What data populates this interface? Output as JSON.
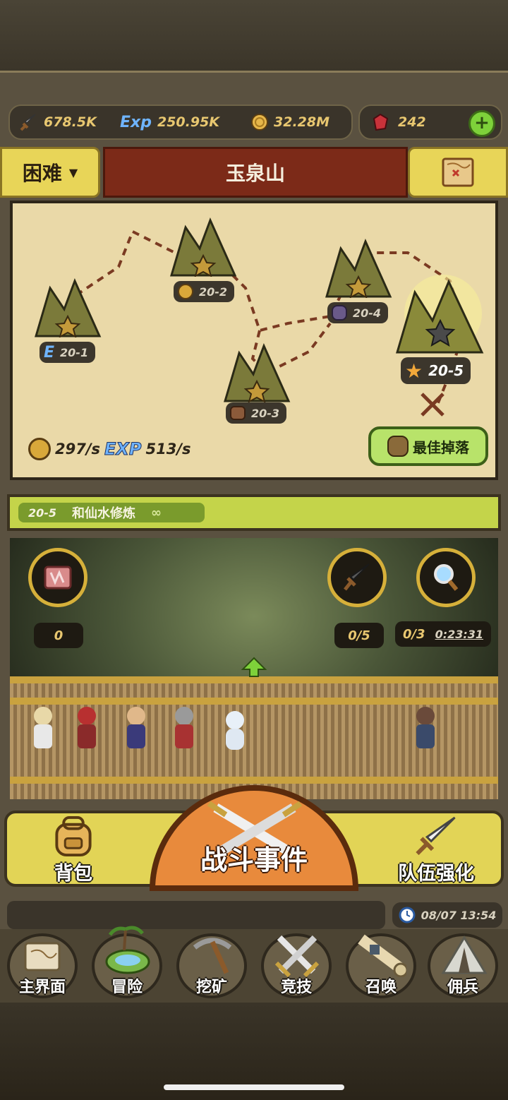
{
  "resources": {
    "attack": {
      "icon": "sword-icon",
      "value": "678.5K"
    },
    "exp": {
      "icon": "exp-icon",
      "value": "250.95K"
    },
    "gold": {
      "icon": "gold-coin-icon",
      "value": "32.28M"
    },
    "gems": {
      "icon": "gem-icon",
      "value": "242"
    },
    "add": "+"
  },
  "header": {
    "difficulty": "困难",
    "zone_name": "玉泉山",
    "map_icon": "treasure-map-icon"
  },
  "map": {
    "stages": [
      {
        "id": "20-1",
        "icon": "e-rank-icon",
        "icon_text": "E"
      },
      {
        "id": "20-2",
        "icon": "coin-icon"
      },
      {
        "id": "20-3",
        "icon": "ore-icon"
      },
      {
        "id": "20-4",
        "icon": "bag-icon"
      },
      {
        "id": "20-5",
        "icon": "star-icon",
        "current": true
      }
    ],
    "gold_rate": "297/s",
    "exp_label": "EXP",
    "exp_rate": "513/s",
    "best_drop": "最佳掉落"
  },
  "quest": {
    "stage": "20-5",
    "name": "和仙水修炼",
    "repeat": "∞"
  },
  "scene": {
    "scroll_count": "0",
    "sword_count": "0/5",
    "search_count": "0/3",
    "timer": "0:23:31"
  },
  "actions": {
    "bag": "背包",
    "battle_event": "战斗事件",
    "team_upgrade": "队伍强化"
  },
  "clock": "08/07 13:54",
  "nav": [
    {
      "label": "主界面",
      "icon": "scroll-map-icon"
    },
    {
      "label": "冒险",
      "icon": "island-icon"
    },
    {
      "label": "挖矿",
      "icon": "pickaxe-icon"
    },
    {
      "label": "竞技",
      "icon": "crossed-swords-icon"
    },
    {
      "label": "召唤",
      "icon": "summon-scroll-icon"
    },
    {
      "label": "佣兵",
      "icon": "tent-icon"
    }
  ],
  "colors": {
    "gold_text": "#e8c770",
    "yellow_panel": "#e2d456",
    "zone_red": "#7c2a18",
    "green_accent": "#7ed13a",
    "battle_orange": "#e88a3c"
  }
}
